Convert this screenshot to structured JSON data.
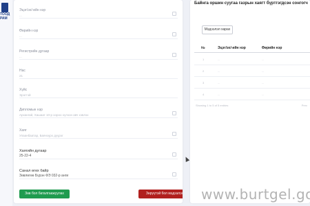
{
  "logo": {
    "line1": "ТООД",
    "line2": "РАМ"
  },
  "form": {
    "fields": [
      {
        "label": "Эцэг/эх/-ийн нэр",
        "value": "..."
      },
      {
        "label": "Өөрийн нэр",
        "value": "..."
      },
      {
        "label": "Регистрийн дугаар",
        "value": "..."
      },
      {
        "label": "Нас",
        "value": "21"
      },
      {
        "label": "Хүйс",
        "value": "Эрэгтэй"
      },
      {
        "label": "Дипломын нэр",
        "value": "Архангай, Хашаат 10-р хороо хүлээн авч хэвлэх"
      },
      {
        "label": "Хаяг",
        "value": "Улаанбаатар, Баянзүрх дүүрэг"
      },
      {
        "label": "Хаягийн дугаар",
        "value": "25-22-4"
      },
      {
        "label": "Санал өгөх байр",
        "value": "Зөвлөгөө Бүрэн ФЭ 032-р анги"
      }
    ],
    "confirm_button": "Зөв бол баталгаажуулах",
    "report_button": "Зөрүүтэй бол мэдээлэх"
  },
  "panel": {
    "title": "Байнга оршин суугаа газрын хаягт бүртгэгдсэн сонгогч",
    "view_button": "Мэдээлэл харах",
    "table": {
      "headers": [
        "№",
        "Эцэг/эх/-ийн нэр",
        "Өөрийн нэр"
      ],
      "rows": [
        [
          "1",
          "...",
          "..."
        ],
        [
          "2",
          "...",
          "..."
        ],
        [
          "3",
          "...",
          "..."
        ],
        [
          "4",
          "...",
          "..."
        ],
        [
          "5",
          "...",
          "..."
        ]
      ]
    },
    "info": "Showing 1 to 5 of 5 entries",
    "pager": "Prev"
  },
  "watermark": "www.burtgel.gov"
}
